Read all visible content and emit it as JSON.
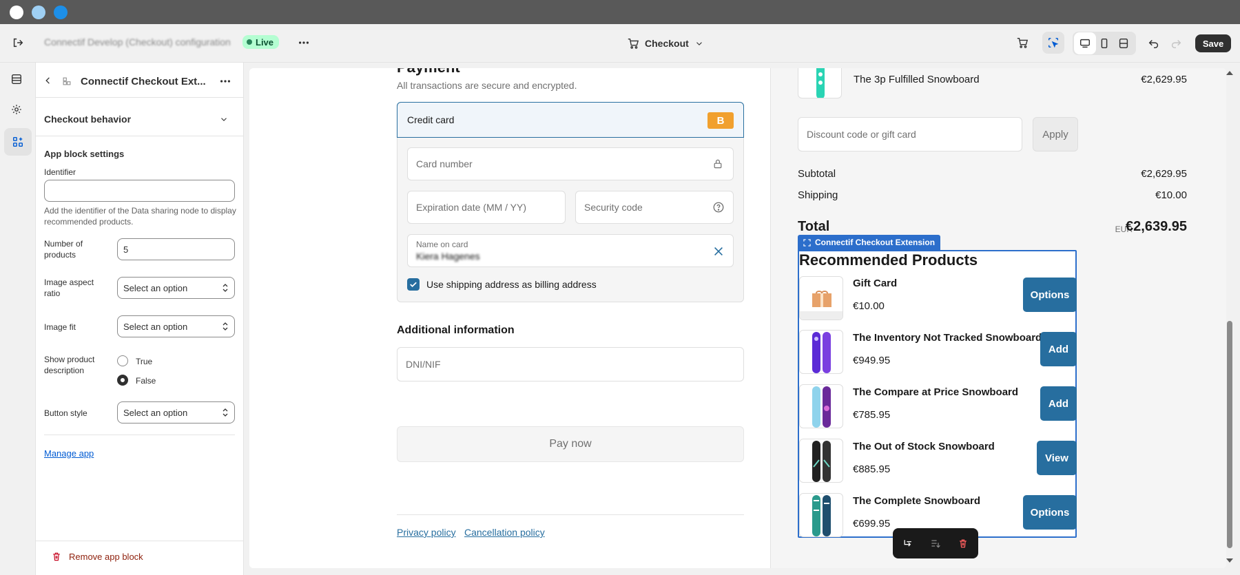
{
  "window": {
    "dots": [
      "#ffffff",
      "#9fd0f4",
      "#1d8fe8"
    ]
  },
  "topbar": {
    "exit_icon": "exit-icon",
    "config_title": "Connectif Develop (Checkout) configuration",
    "live_label": "Live",
    "more_icon": "more-horizontal-icon",
    "page_selector": "Checkout",
    "save_label": "Save"
  },
  "sidebar": {
    "title": "Connectif Checkout Ext...",
    "section_label": "Checkout behavior",
    "app_block_settings": "App block settings",
    "identifier_label": "Identifier",
    "identifier_value": "",
    "identifier_help": "Add the identifier of the Data sharing node to display recommended products.",
    "num_products_label": "Number of products",
    "num_products_value": "5",
    "image_aspect_label": "Image aspect ratio",
    "image_aspect_value": "Select an option",
    "image_fit_label": "Image fit",
    "image_fit_value": "Select an option",
    "show_desc_label": "Show product description",
    "radio_true": "True",
    "radio_false": "False",
    "button_style_label": "Button style",
    "button_style_value": "Select an option",
    "manage_app": "Manage app",
    "remove_block": "Remove app block"
  },
  "checkout": {
    "payment_heading": "Payment",
    "payment_sub": "All transactions are secure and encrypted.",
    "credit_card": "Credit card",
    "card_badge": "B",
    "card_number": "Card number",
    "expiration": "Expiration date (MM / YY)",
    "security_code": "Security code",
    "name_on_card_label": "Name on card",
    "name_on_card_value": "Kiera Hagenes",
    "billing_checkbox": "Use shipping address as billing address",
    "additional_heading": "Additional information",
    "dni_placeholder": "DNI/NIF",
    "pay_now": "Pay now",
    "privacy": "Privacy policy",
    "cancellation": "Cancellation policy"
  },
  "summary": {
    "top_item_name": "The 3p Fulfilled Snowboard",
    "top_item_price": "€2,629.95",
    "discount_placeholder": "Discount code or gift card",
    "apply": "Apply",
    "subtotal_label": "Subtotal",
    "subtotal_value": "€2,629.95",
    "shipping_label": "Shipping",
    "shipping_value": "€10.00",
    "total_label": "Total",
    "currency": "EUR",
    "total_value": "€2,639.95"
  },
  "extension": {
    "tag": "Connectif Checkout Extension",
    "heading": "Recommended Products",
    "items": [
      {
        "name": "Gift Card",
        "price": "€10.00",
        "button": "Options"
      },
      {
        "name": "The Inventory Not Tracked Snowboard",
        "price": "€949.95",
        "button": "Add"
      },
      {
        "name": "The Compare at Price Snowboard",
        "price": "€785.95",
        "button": "Add"
      },
      {
        "name": "The Out of Stock Snowboard",
        "price": "€885.95",
        "button": "View"
      },
      {
        "name": "The Complete Snowboard",
        "price": "€699.95",
        "button": "Options"
      }
    ]
  }
}
